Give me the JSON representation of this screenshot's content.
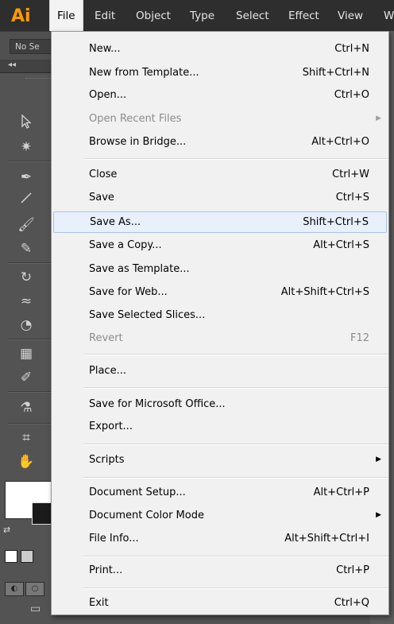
{
  "app": {
    "logo": "Ai"
  },
  "menubar": {
    "items": [
      "File",
      "Edit",
      "Object",
      "Type",
      "Select",
      "Effect",
      "View",
      "W"
    ]
  },
  "controlbar": {
    "selection": "No Se"
  },
  "toolbar": {
    "tools": [
      "selection-tool",
      "magic-wand-tool",
      "pen-tool",
      "line-tool",
      "paintbrush-tool",
      "blob-brush-tool",
      "rotate-tool",
      "warp-tool",
      "shape-builder-tool",
      "perspective-grid-tool",
      "eyedropper-tool",
      "symbol-sprayer-tool",
      "artboard-tool",
      "hand-tool"
    ],
    "fill_color": "#ffffff",
    "stroke_color": "#1a1a1a"
  },
  "file_menu": {
    "items": [
      {
        "label": "New...",
        "shortcut": "Ctrl+N"
      },
      {
        "label": "New from Template...",
        "shortcut": "Shift+Ctrl+N"
      },
      {
        "label": "Open...",
        "shortcut": "Ctrl+O"
      },
      {
        "label": "Open Recent Files",
        "shortcut": "",
        "disabled": true,
        "submenu": true
      },
      {
        "label": "Browse in Bridge...",
        "shortcut": "Alt+Ctrl+O"
      },
      {
        "label": "Close",
        "shortcut": "Ctrl+W"
      },
      {
        "label": "Save",
        "shortcut": "Ctrl+S"
      },
      {
        "label": "Save As...",
        "shortcut": "Shift+Ctrl+S",
        "highlighted": true
      },
      {
        "label": "Save a Copy...",
        "shortcut": "Alt+Ctrl+S"
      },
      {
        "label": "Save as Template...",
        "shortcut": ""
      },
      {
        "label": "Save for Web...",
        "shortcut": "Alt+Shift+Ctrl+S"
      },
      {
        "label": "Save Selected Slices...",
        "shortcut": ""
      },
      {
        "label": "Revert",
        "shortcut": "F12",
        "disabled": true
      },
      {
        "label": "Place...",
        "shortcut": ""
      },
      {
        "label": "Save for Microsoft Office...",
        "shortcut": ""
      },
      {
        "label": "Export...",
        "shortcut": ""
      },
      {
        "label": "Scripts",
        "shortcut": "",
        "submenu": true
      },
      {
        "label": "Document Setup...",
        "shortcut": "Alt+Ctrl+P"
      },
      {
        "label": "Document Color Mode",
        "shortcut": "",
        "submenu": true
      },
      {
        "label": "File Info...",
        "shortcut": "Alt+Shift+Ctrl+I"
      },
      {
        "label": "Print...",
        "shortcut": "Ctrl+P"
      },
      {
        "label": "Exit",
        "shortcut": "Ctrl+Q"
      }
    ]
  },
  "colors": {
    "accent": "#ff9a00",
    "highlight_bg": "#e8f0fb",
    "highlight_border": "#a8c3e8"
  }
}
